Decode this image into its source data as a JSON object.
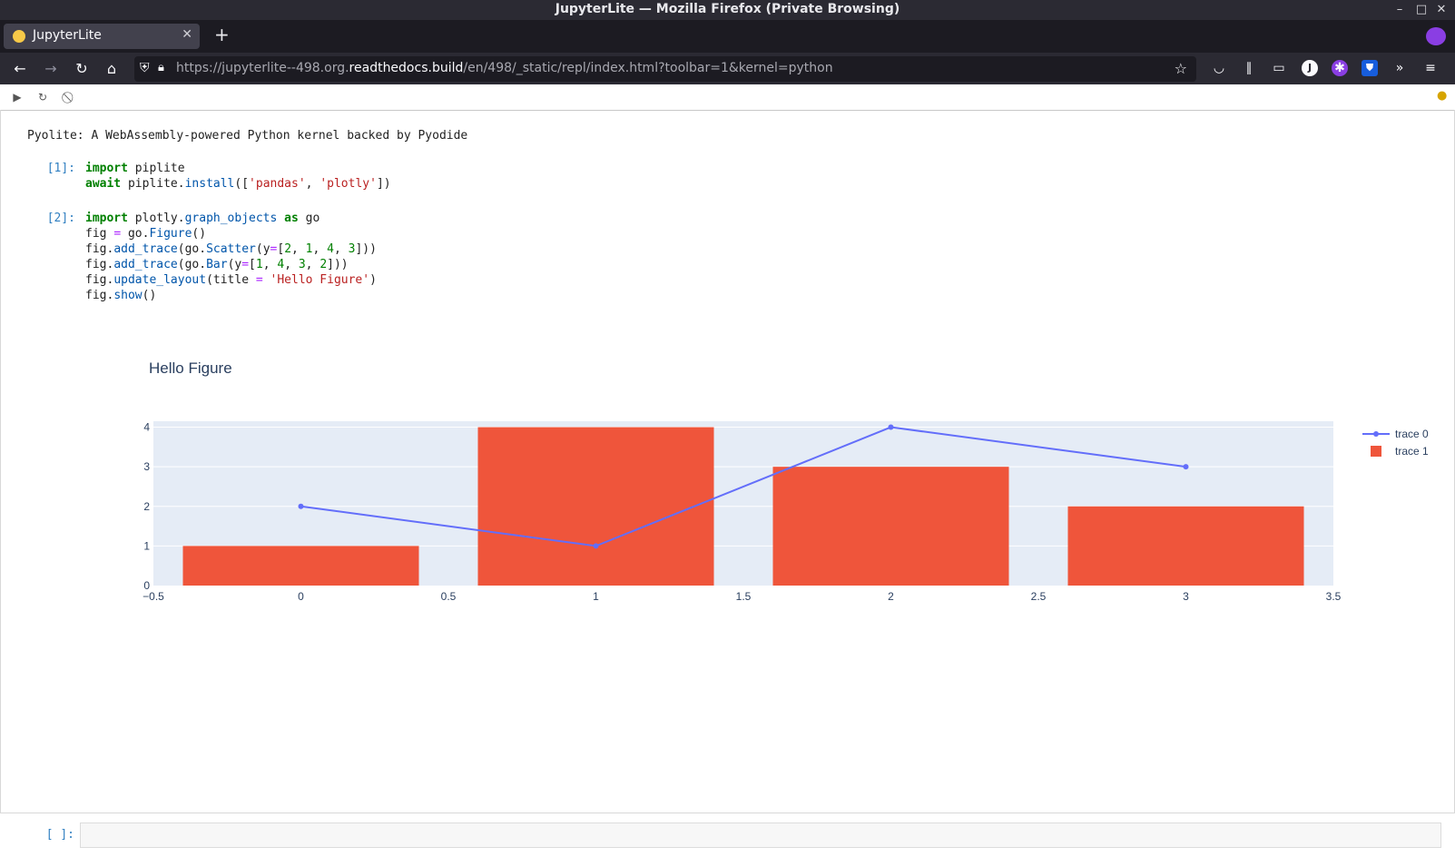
{
  "window": {
    "title": "JupyterLite — Mozilla Firefox (Private Browsing)",
    "controls": [
      "minimize-icon",
      "maximize-icon",
      "close-icon"
    ]
  },
  "tab": {
    "label": "JupyterLite",
    "close": "✕",
    "new_tab": "+"
  },
  "address": {
    "url_prefix": "https://jupyterlite--498.org.",
    "url_host": "readthedocs.build",
    "url_suffix": "/en/498/_static/repl/index.html?toolbar=1&kernel=python"
  },
  "colors": {
    "accent": "#636efa",
    "bar": "#ef553b",
    "plot_bg": "#e5ecf6",
    "chrome": "#2b2a33"
  },
  "notebook": {
    "banner": "Pyolite: A WebAssembly-powered Python kernel backed by Pyodide",
    "cells": [
      {
        "prompt": "[1]:",
        "lines": [
          "import piplite",
          "await piplite.install(['pandas', 'plotly'])"
        ]
      },
      {
        "prompt": "[2]:",
        "lines": [
          "import plotly.graph_objects as go",
          "fig = go.Figure()",
          "fig.add_trace(go.Scatter(y=[2, 1, 4, 3]))",
          "fig.add_trace(go.Bar(y=[1, 4, 3, 2]))",
          "fig.update_layout(title = 'Hello Figure')",
          "fig.show()"
        ]
      }
    ],
    "empty_prompt": "[ ]:"
  },
  "chart_data": {
    "type": "bar",
    "title": "Hello Figure",
    "xlabel": "",
    "ylabel": "",
    "xlim": [
      -0.5,
      3.5
    ],
    "ylim": [
      0,
      4.15
    ],
    "x_ticks": [
      "−0.5",
      "0",
      "0.5",
      "1",
      "1.5",
      "2",
      "2.5",
      "3",
      "3.5"
    ],
    "y_ticks": [
      "0",
      "1",
      "2",
      "3",
      "4"
    ],
    "grid": true,
    "legend_position": "right",
    "series": [
      {
        "name": "trace 0",
        "type": "line",
        "x": [
          0,
          1,
          2,
          3
        ],
        "values": [
          2,
          1,
          4,
          3
        ],
        "color": "#636efa"
      },
      {
        "name": "trace 1",
        "type": "bar",
        "x": [
          0,
          1,
          2,
          3
        ],
        "values": [
          1,
          4,
          3,
          2
        ],
        "color": "#ef553b"
      }
    ]
  }
}
